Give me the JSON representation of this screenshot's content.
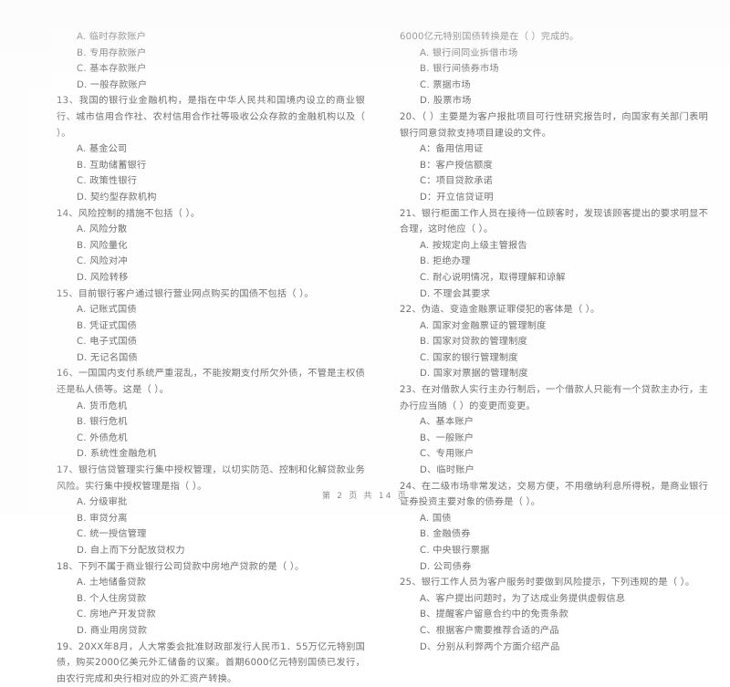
{
  "document": {
    "type": "exam-paper",
    "language": "zh-CN",
    "footer": "第 2 页 共 14 页",
    "text_color": "#6f6f71"
  },
  "left_column": {
    "leading_options": [
      "A. 临时存款账户",
      "B. 专用存款账户",
      "C. 基本存款账户",
      "D. 一般存款账户"
    ],
    "questions": [
      {
        "number": "13",
        "stem": "13、我国的银行业金融机构，是指在中华人民共和国境内设立的商业银行、城市信用合作社、农村信用合作社等吸收公众存款的金融机构以及（      ）。",
        "options": [
          "A. 基金公司",
          "B. 互助储蓄银行",
          "C. 政策性银行",
          "D. 契约型存款机构"
        ]
      },
      {
        "number": "14",
        "stem": "14、风险控制的措施不包括（      ）。",
        "options": [
          "A. 风险分散",
          "B. 风险量化",
          "C. 风险对冲",
          "D. 风险转移"
        ]
      },
      {
        "number": "15",
        "stem": "15、目前银行客户通过银行营业网点购买的国债不包括（      ）。",
        "options": [
          "A. 记账式国债",
          "B. 凭证式国债",
          "C. 电子式国债",
          "D. 无记名国债"
        ]
      },
      {
        "number": "16",
        "stem": "16、一国国内支付系统严重混乱，不能按期支付所欠外债，不管是主权债还是私人债等。这是（      ）。",
        "options": [
          "A. 货币危机",
          "B. 银行危机",
          "C. 外债危机",
          "D. 系统性金融危机"
        ]
      },
      {
        "number": "17",
        "stem": "17、银行信贷管理实行集中授权管理，以切实防范、控制和化解贷款业务风险。实行集中授权管理是指（      ）。",
        "options": [
          "A. 分级审批",
          "B. 审贷分离",
          "C. 统一授信管理",
          "D. 自上而下分配放贷权力"
        ]
      },
      {
        "number": "18",
        "stem": "18、下列不属于商业银行公司贷款中房地产贷款的是（      ）。",
        "options": [
          "A. 土地储备贷款",
          "B. 个人住房贷款",
          "C. 房地产开发贷款",
          "D. 商业用房贷款"
        ]
      },
      {
        "number": "19",
        "stem": "19、20XX年8月，人大常委会批准财政部发行人民币1．55万亿元特别国债，购买2000亿美元外汇储备的议案。首期6000亿元特别国债已发行，由农行完成和央行相对应的外汇资产转换。",
        "options": []
      }
    ]
  },
  "right_column": {
    "questions": [
      {
        "number": "19-cont",
        "stem": "6000亿元特别国债转换是在（      ）完成的。",
        "options": [
          "A. 银行间同业拆借市场",
          "B. 银行间债券市场",
          "C. 票据市场",
          "D. 股票市场"
        ]
      },
      {
        "number": "20",
        "stem": "20、（      ）主要是为客户报批项目可行性研究报告时，向国家有关部门表明银行同意贷款支持项目建设的文件。",
        "options": [
          "A：备用信用证",
          "B：客户授信额度",
          "C：项目贷款承诺",
          "D：开立信贷证明"
        ]
      },
      {
        "number": "21",
        "stem": "21、银行柜面工作人员在接待一位顾客时，发现该顾客提出的要求明显不合理，这时他应（      ）。",
        "options": [
          "A. 按规定向上级主管报告",
          "B. 拒绝办理",
          "C. 耐心说明情况，取得理解和谅解",
          "D. 不理会其要求"
        ]
      },
      {
        "number": "22",
        "stem": "22、伪造、变造金融票证罪侵犯的客体是（      ）。",
        "options": [
          "A. 国家对金融票证的管理制度",
          "B. 国家对贷款的管理制度",
          "C. 国家的银行管理制度",
          "D. 国家对票据的管理制度"
        ]
      },
      {
        "number": "23",
        "stem": "23、在对借款人实行主办行制后，一个借款人只能有一个贷款主办行，主办行应当随（      ）的变更而变更。",
        "options": [
          "A、基本账户",
          "B、一般账户",
          "C、专用账户",
          "D、临时账户"
        ]
      },
      {
        "number": "24",
        "stem": "24、在二级市场非常发达，交易方便，不用缴纳利息所得税，是商业银行证券投资主要对象的债券是（      ）。",
        "options": [
          "A. 国债",
          "B. 金融债券",
          "C. 中央银行票据",
          "D. 公司债券"
        ]
      },
      {
        "number": "25",
        "stem": "25、银行工作人员为客户服务时要做到风险提示，下列违规的是（      ）。",
        "options": [
          "A、客户提出问题时，为了达成业务提供虚假信息",
          "B、提醒客户留意合约中的免责条款",
          "C、根据客户需要推荐合适的产品",
          "D、分别从利弊两个方面介绍产品"
        ]
      }
    ]
  }
}
